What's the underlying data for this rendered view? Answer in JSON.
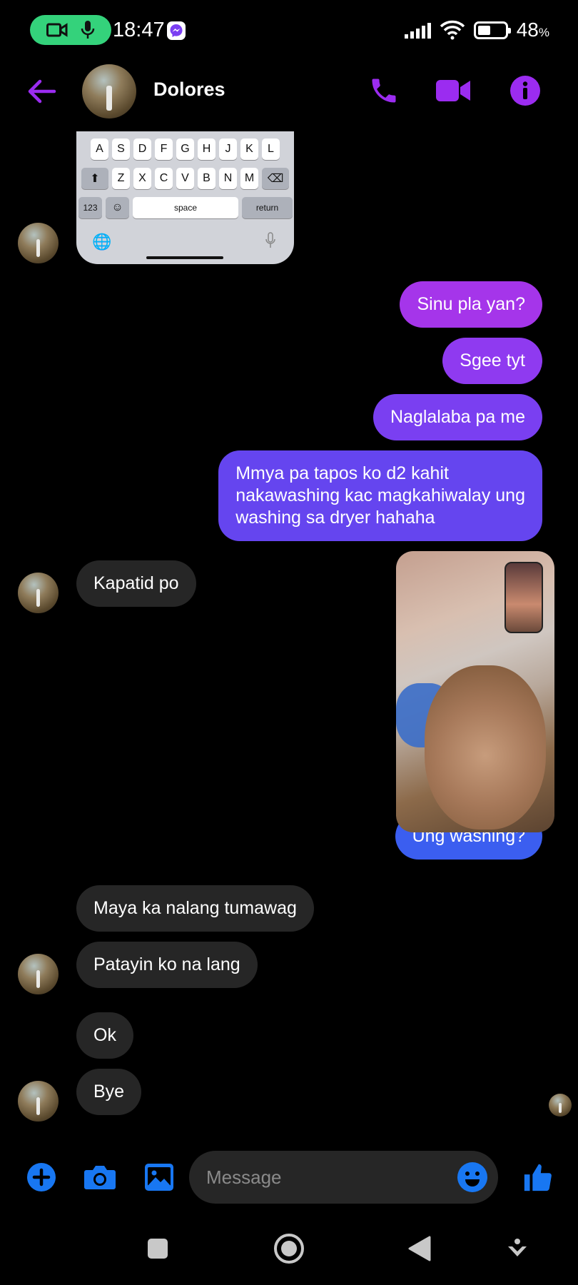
{
  "status_bar": {
    "time": "18:47",
    "battery_percent": "48",
    "battery_unit": "%",
    "call_pill_color": "#34d27b",
    "icons": [
      "video-call-icon",
      "mic-icon",
      "messenger-icon",
      "signal-icon",
      "wifi-icon",
      "battery-icon"
    ]
  },
  "header": {
    "contact_name": "Dolores",
    "accent": "#9b2cf0",
    "actions": [
      "back-arrow-icon",
      "phone-icon",
      "video-camera-icon",
      "info-icon"
    ]
  },
  "keyboard_attachment": {
    "row1": [
      "A",
      "S",
      "D",
      "F",
      "G",
      "H",
      "J",
      "K",
      "L"
    ],
    "row2": [
      "Z",
      "X",
      "C",
      "V",
      "B",
      "N",
      "M"
    ],
    "num_key": "123",
    "space_key": "space",
    "return_key": "return"
  },
  "messages": [
    {
      "side": "out",
      "text": "Sinu pla yan?"
    },
    {
      "side": "out",
      "text": "Sgee tyt"
    },
    {
      "side": "out",
      "text": "Naglalaba pa me"
    },
    {
      "side": "out",
      "lines": [
        "Mmya pa tapos ko d2 kahit",
        "nakawashing kac magkahiwalay ung",
        "washing sa dryer hahaha"
      ]
    },
    {
      "side": "in",
      "text": "Kapatid po"
    },
    {
      "side": "out",
      "text": "Ung washing?"
    },
    {
      "side": "in",
      "text": "Maya ka nalang tumawag"
    },
    {
      "side": "in",
      "text": "Patayin ko na lang"
    },
    {
      "side": "in",
      "text": "Ok"
    },
    {
      "side": "in",
      "text": "Bye"
    }
  ],
  "composer": {
    "placeholder": "Message",
    "accent": "#1877f2",
    "icons": [
      "plus-icon",
      "camera-icon",
      "gallery-icon",
      "emoji-icon",
      "thumbs-up-icon"
    ]
  },
  "nav": {
    "icons": [
      "recents-icon",
      "home-icon",
      "back-icon",
      "assistant-icon"
    ]
  }
}
